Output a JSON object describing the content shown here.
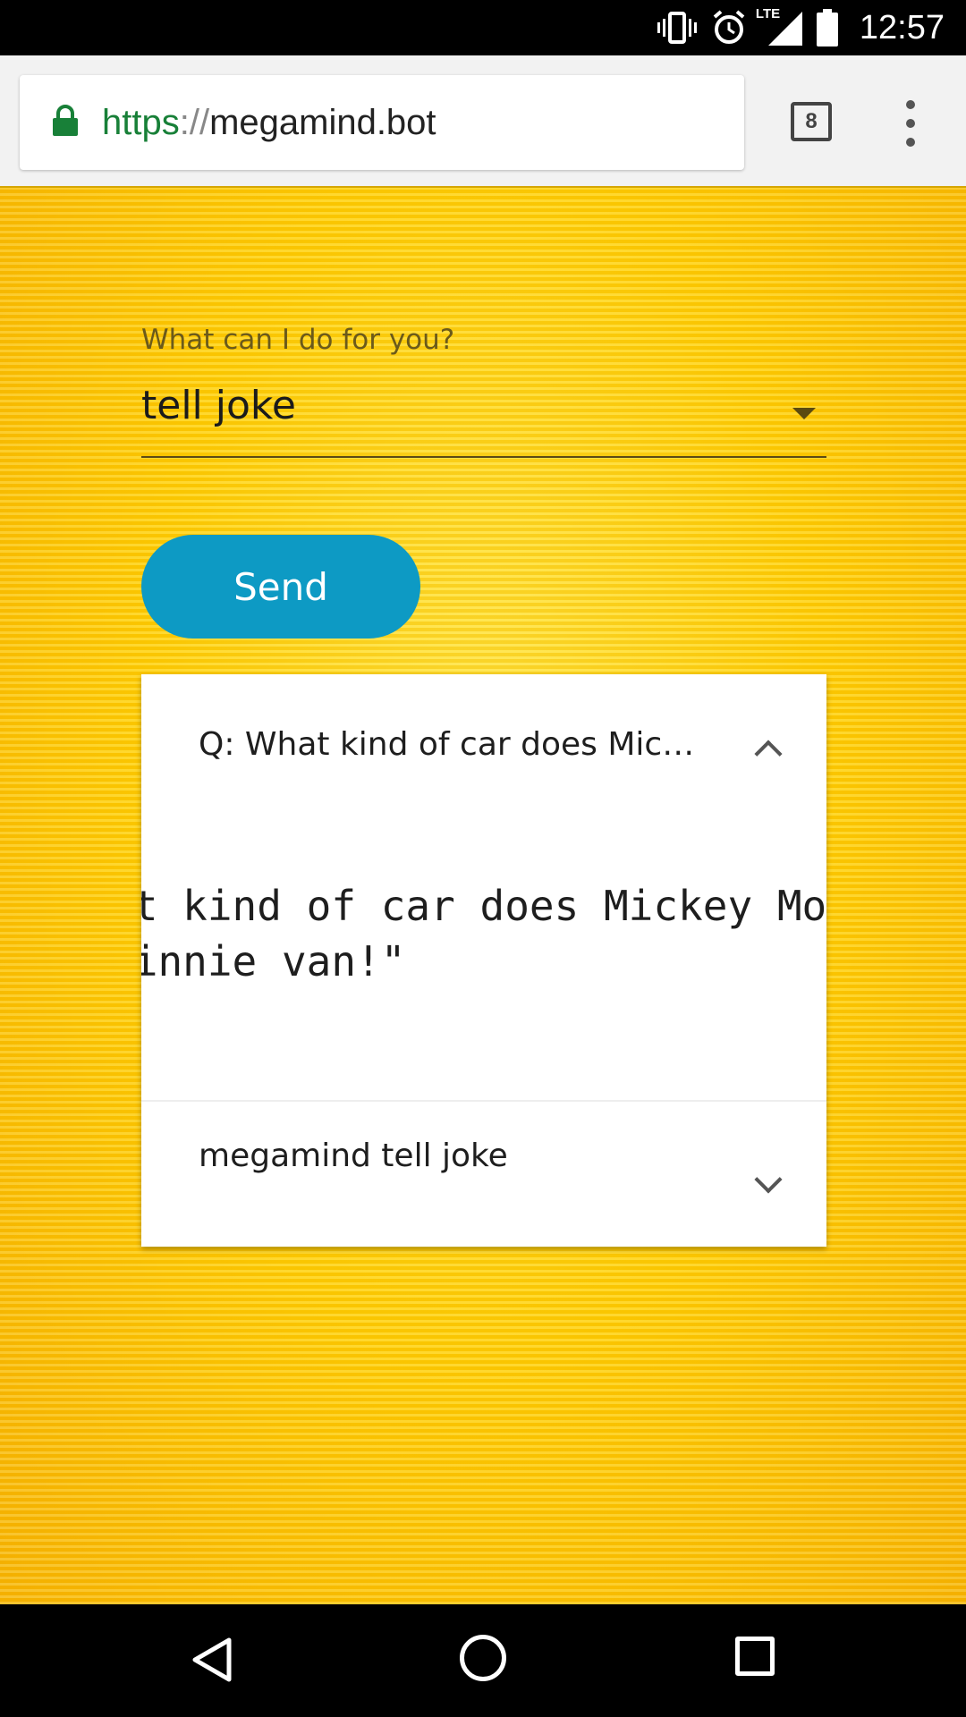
{
  "status_bar": {
    "time": "12:57",
    "network_label": "LTE",
    "icons": [
      "vibrate-icon",
      "alarm-icon",
      "signal-icon",
      "battery-icon"
    ]
  },
  "browser": {
    "url_scheme": "https",
    "url_separator": "://",
    "url_host": "megamind.bot",
    "tab_count": "8",
    "icons": [
      "lock-icon",
      "tab-switcher-icon",
      "overflow-menu-icon"
    ]
  },
  "form": {
    "label": "What can I do for you?",
    "selected_value": "tell joke",
    "send_label": "Send"
  },
  "accordion": {
    "panels": [
      {
        "title": "Q: What kind of car does Mickey Mouse's wife drive?",
        "expanded": true,
        "body_line1": "\"What kind of car does Mickey Mouse's wife drive?",
        "body_line2": " A minnie van!\""
      },
      {
        "title": "megamind tell joke",
        "expanded": false
      }
    ]
  },
  "colors": {
    "accent_button": "#0d9ac4",
    "background_yellow": "#ffd000",
    "url_scheme_green": "#188038"
  },
  "nav_bar": {
    "icons": [
      "back-icon",
      "home-icon",
      "recents-icon"
    ]
  }
}
